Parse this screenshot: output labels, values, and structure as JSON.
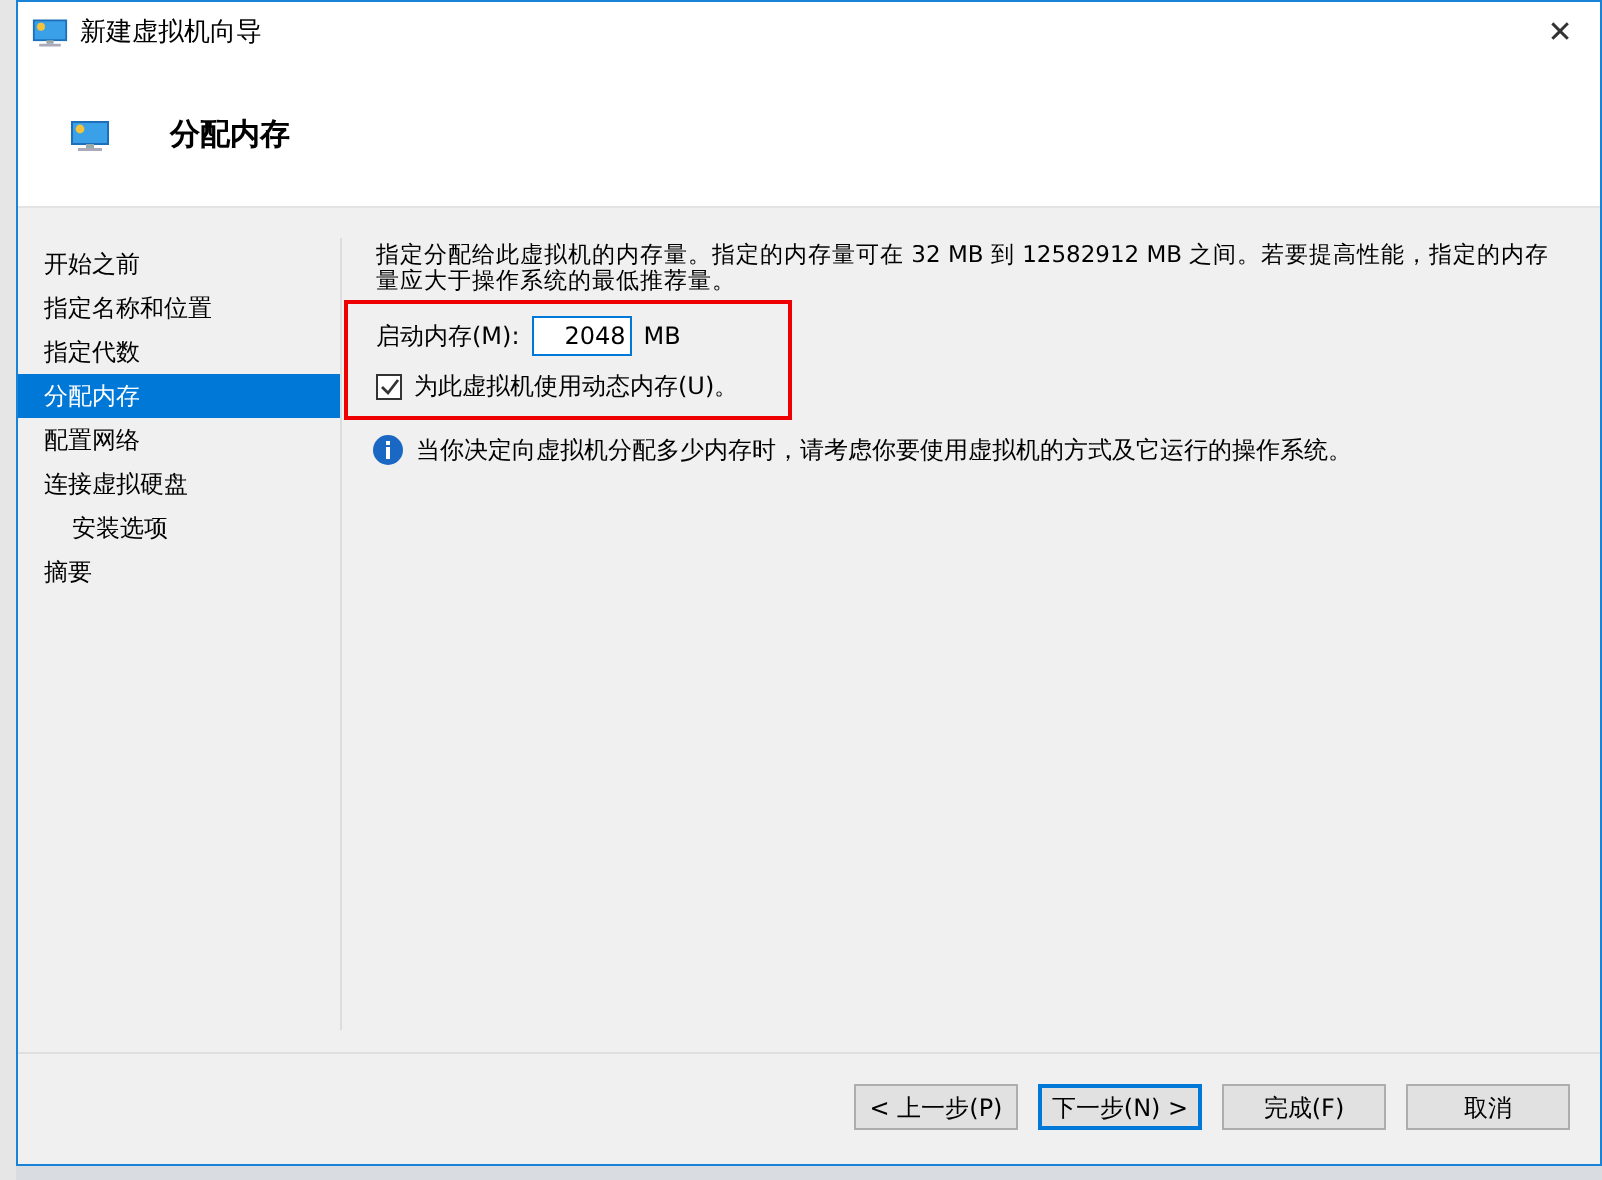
{
  "window": {
    "title": "新建虚拟机向导",
    "close": "✕"
  },
  "header": {
    "title": "分配内存"
  },
  "nav": [
    {
      "label": "开始之前",
      "selected": false
    },
    {
      "label": "指定名称和位置",
      "selected": false
    },
    {
      "label": "指定代数",
      "selected": false
    },
    {
      "label": "分配内存",
      "selected": true
    },
    {
      "label": "配置网络",
      "selected": false
    },
    {
      "label": "连接虚拟硬盘",
      "selected": false,
      "children": [
        {
          "label": "安装选项",
          "selected": false
        }
      ]
    },
    {
      "label": "摘要",
      "selected": false
    }
  ],
  "description": "指定分配给此虚拟机的内存量。指定的内存量可在 32 MB 到 12582912 MB 之间。若要提高性能，指定的内存量应大于操作系统的最低推荐量。",
  "startup_memory": {
    "label": "启动内存(M):",
    "value": "2048",
    "unit": "MB"
  },
  "dynamic_memory": {
    "label": "为此虚拟机使用动态内存(U)。",
    "checked": true
  },
  "info": "当你决定向虚拟机分配多少内存时，请考虑你要使用虚拟机的方式及它运行的操作系统。",
  "buttons": [
    {
      "label": "< 上一步(P)",
      "focused": false
    },
    {
      "label": "下一步(N) >",
      "focused": true
    },
    {
      "label": "完成(F)",
      "focused": false
    },
    {
      "label": "取消",
      "focused": false
    }
  ]
}
